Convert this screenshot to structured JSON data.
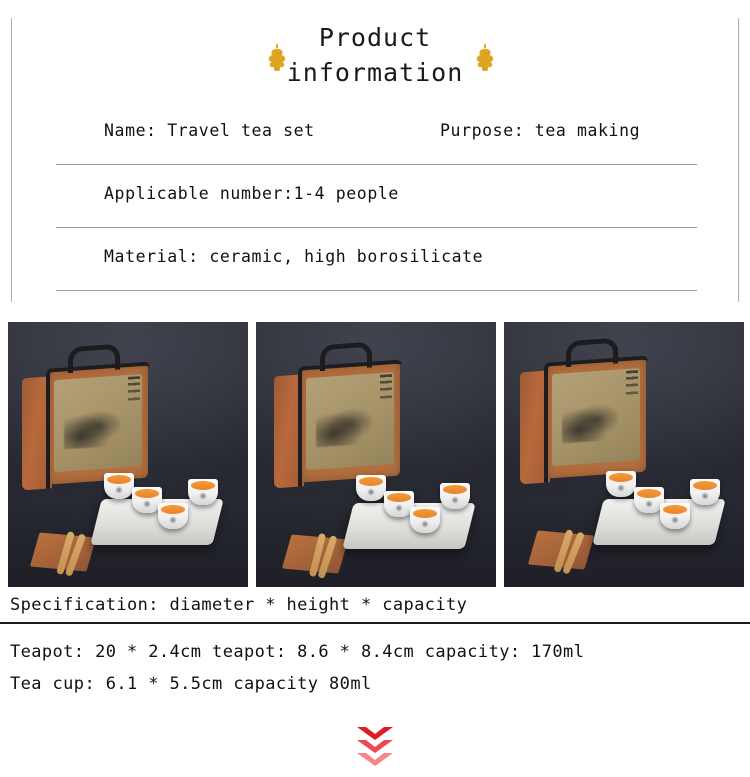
{
  "header": {
    "title": "Product\ninformation",
    "ornament_left": "fleur-de-lis-ornament",
    "ornament_right": "fleur-de-lis-ornament",
    "ornament_color": "#E0A322"
  },
  "info_rows": [
    {
      "left": "Name: Travel tea set",
      "right": "Purpose: tea making"
    },
    {
      "left": "Applicable number:1-4 people",
      "right": ""
    },
    {
      "left": "Material: ceramic, high borosilicate",
      "right": ""
    }
  ],
  "gallery": {
    "images": [
      {
        "alt": "Travel tea set with brown canvas carry bag, white ceramic teapot, four cups of tea and bamboo tray"
      },
      {
        "alt": "Travel tea set front angle with canvas bag, teapot, four tea cups on bamboo tray"
      },
      {
        "alt": "Travel tea set side angle with canvas bag, teapot, four tea cups on bamboo tray"
      }
    ]
  },
  "specification": {
    "heading": "Specification: diameter * height * capacity",
    "lines": [
      "Teapot: 20 * 2.4cm teapot: 8.6 * 8.4cm capacity: 170ml",
      "Tea cup: 6.1 * 5.5cm capacity 80ml"
    ]
  },
  "footer": {
    "chevron_icon": "chevron-down-icon",
    "chevron_colors": [
      "#E01B24",
      "#EC4A52",
      "#F4868C"
    ]
  }
}
